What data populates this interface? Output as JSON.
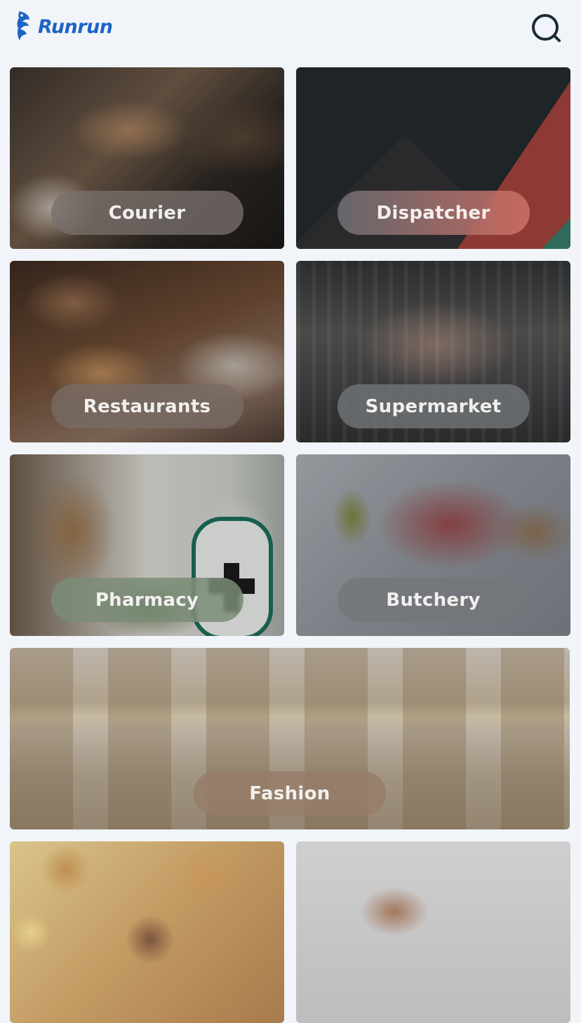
{
  "header": {
    "logo_text": "Runrun",
    "brand_color": "#1f63c7",
    "search_icon": "search-icon"
  },
  "categories": [
    {
      "label": "Courier",
      "pill_color": "rgba(120,112,108,0.78)"
    },
    {
      "label": "Dispatcher",
      "pill_color": "linear-gradient(90deg, rgba(112,112,118,0.85), rgba(205,110,100,0.9))"
    },
    {
      "label": "Restaurants",
      "pill_color": "rgba(120,108,100,0.8)"
    },
    {
      "label": "Supermarket",
      "pill_color": "rgba(112,116,118,0.82)"
    },
    {
      "label": "Pharmacy",
      "pill_color": "rgba(122,140,118,0.85)"
    },
    {
      "label": "Butchery",
      "pill_color": "rgba(115,118,122,0.82)"
    },
    {
      "label": "Fashion",
      "pill_color": "rgba(150,125,105,0.82)"
    },
    {
      "label": "",
      "pill_color": ""
    },
    {
      "label": "",
      "pill_color": ""
    }
  ]
}
